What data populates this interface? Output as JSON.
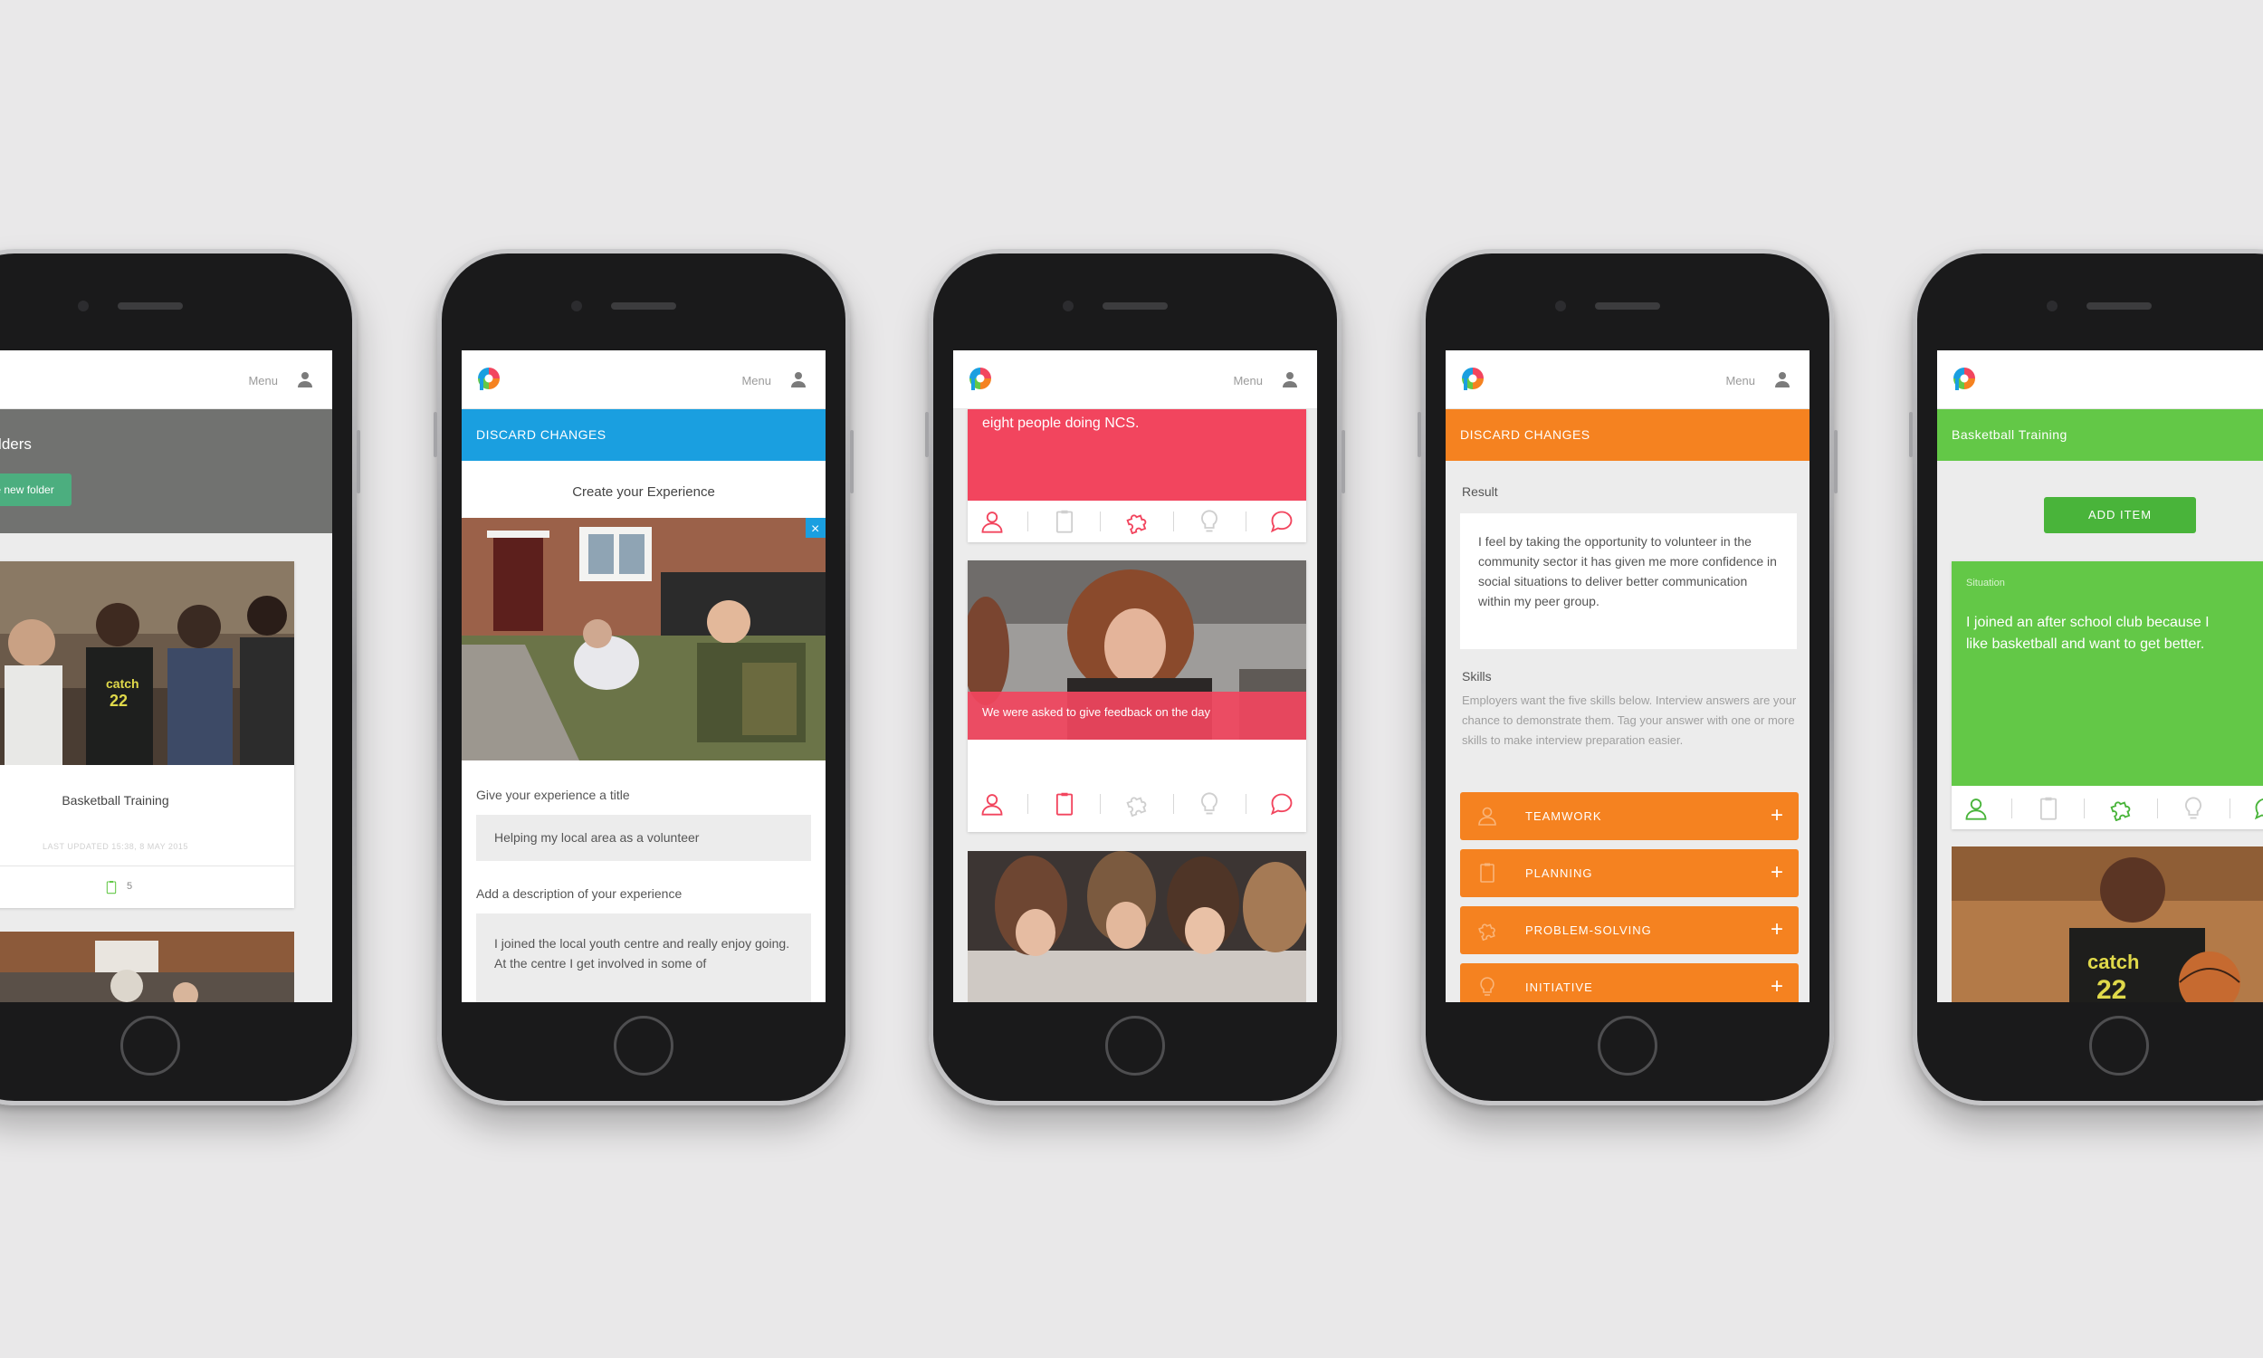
{
  "common": {
    "menu_label": "Menu",
    "colors": {
      "blue": "#1a9fe0",
      "pink": "#f2455e",
      "orange": "#f58220",
      "green": "#63c847",
      "grey": "#717270"
    }
  },
  "phone1": {
    "header_title": "y Folders",
    "create_button": "Create new folder",
    "card_title": "Basketball Training",
    "card_meta": "LAST UPDATED 15:38, 8 MAY 2015",
    "card_count": "5"
  },
  "phone2": {
    "discard_label": "DISCARD CHANGES",
    "page_title": "Create your Experience",
    "title_label": "Give your experience a title",
    "title_value": "Helping my local area as a volunteer",
    "description_label": "Add a description of your experience",
    "description_value": "I joined the local youth centre and really enjoy going. At the centre I get involved in some of"
  },
  "phone3": {
    "banner_text": "eight people doing NCS.",
    "caption": "We were asked to give feedback on the day",
    "icons": [
      "person-icon",
      "clipboard-icon",
      "puzzle-icon",
      "lightbulb-icon",
      "speech-bubble-icon"
    ]
  },
  "phone4": {
    "discard_label": "DISCARD CHANGES",
    "result_label": "Result",
    "result_text": "I feel by taking the opportunity to volunteer in the community sector it has given me more confidence in social situations to deliver better communication within my peer group.",
    "skills_label": "Skills",
    "skills_help": "Employers want the five skills below. Interview answers are your chance to demonstrate them. Tag your answer with one or more skills to make interview preparation easier.",
    "skills": [
      {
        "label": "TEAMWORK",
        "icon": "person-icon"
      },
      {
        "label": "PLANNING",
        "icon": "clipboard-icon"
      },
      {
        "label": "PROBLEM-SOLVING",
        "icon": "puzzle-icon"
      },
      {
        "label": "INITIATIVE",
        "icon": "lightbulb-icon"
      }
    ]
  },
  "phone5": {
    "bar_title": "Basketball Training",
    "add_button": "ADD ITEM",
    "situation_label": "Situation",
    "situation_text": "I joined an after school club because I like basketball and want to get better."
  }
}
